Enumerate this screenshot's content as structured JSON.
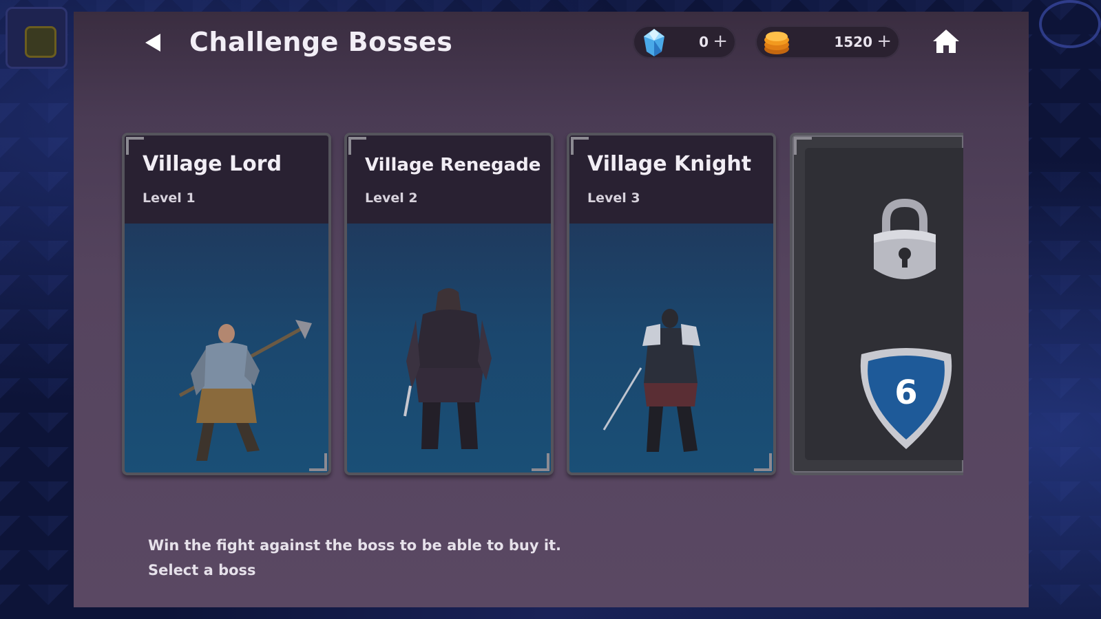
{
  "header": {
    "title": "Challenge Bosses",
    "back_icon": "back-arrow-icon",
    "home_icon": "home-icon"
  },
  "currencies": {
    "gems": {
      "icon": "gem-icon",
      "value": "0",
      "plus": "+"
    },
    "coins": {
      "icon": "coin-stack-icon",
      "value": "1520",
      "plus": "+"
    }
  },
  "bosses": [
    {
      "name": "Village Lord",
      "level": "Level 1",
      "state": "unlocked"
    },
    {
      "name": "Village Renegade",
      "level": "Level 2",
      "state": "unlocked"
    },
    {
      "name": "Village Knight",
      "level": "Level 3",
      "state": "unlocked"
    }
  ],
  "locked_boss": {
    "icon": "padlock-icon",
    "required_level": "6",
    "badge_icon": "shield-icon"
  },
  "footer": {
    "message": "Win the fight against the boss to be able to buy it.",
    "hint": "Select a boss"
  },
  "colors": {
    "panel": "#55445e",
    "card_header": "#292132",
    "card_art": "#1b476e",
    "shield_blue": "#1e5a99"
  }
}
